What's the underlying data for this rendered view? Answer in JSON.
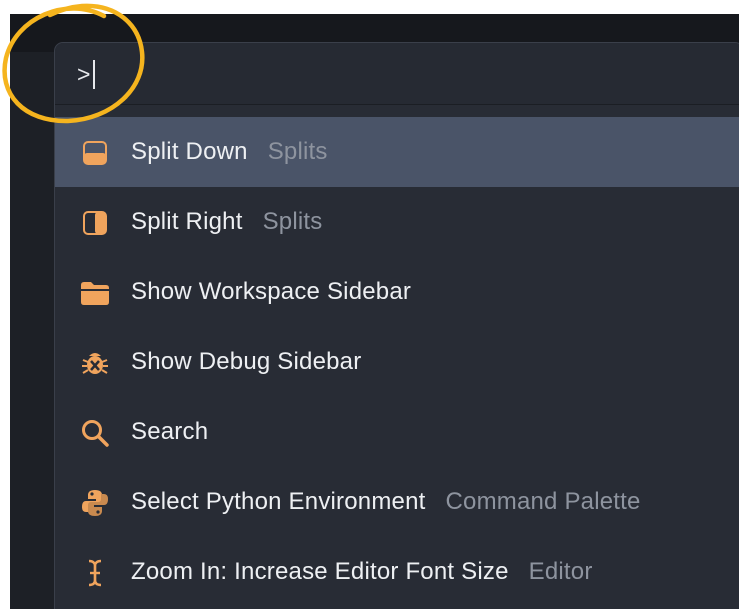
{
  "search": {
    "value": ">",
    "placeholder": ""
  },
  "commands": [
    {
      "label": "Split Down",
      "category": "Splits",
      "icon": "split-down-icon",
      "selected": true
    },
    {
      "label": "Split Right",
      "category": "Splits",
      "icon": "split-right-icon",
      "selected": false
    },
    {
      "label": "Show Workspace Sidebar",
      "category": "",
      "icon": "folder-icon",
      "selected": false
    },
    {
      "label": "Show Debug Sidebar",
      "category": "",
      "icon": "bug-icon",
      "selected": false
    },
    {
      "label": "Search",
      "category": "",
      "icon": "search-icon",
      "selected": false
    },
    {
      "label": "Select Python Environment",
      "category": "Command Palette",
      "icon": "python-icon",
      "selected": false
    },
    {
      "label": "Zoom In: Increase Editor Font Size",
      "category": "Editor",
      "icon": "text-cursor-icon",
      "selected": false
    }
  ],
  "colors": {
    "accent": "#f0a45d",
    "annotation": "#f5b41e",
    "selected_row": "#4a5468",
    "palette_bg": "#282c35"
  }
}
